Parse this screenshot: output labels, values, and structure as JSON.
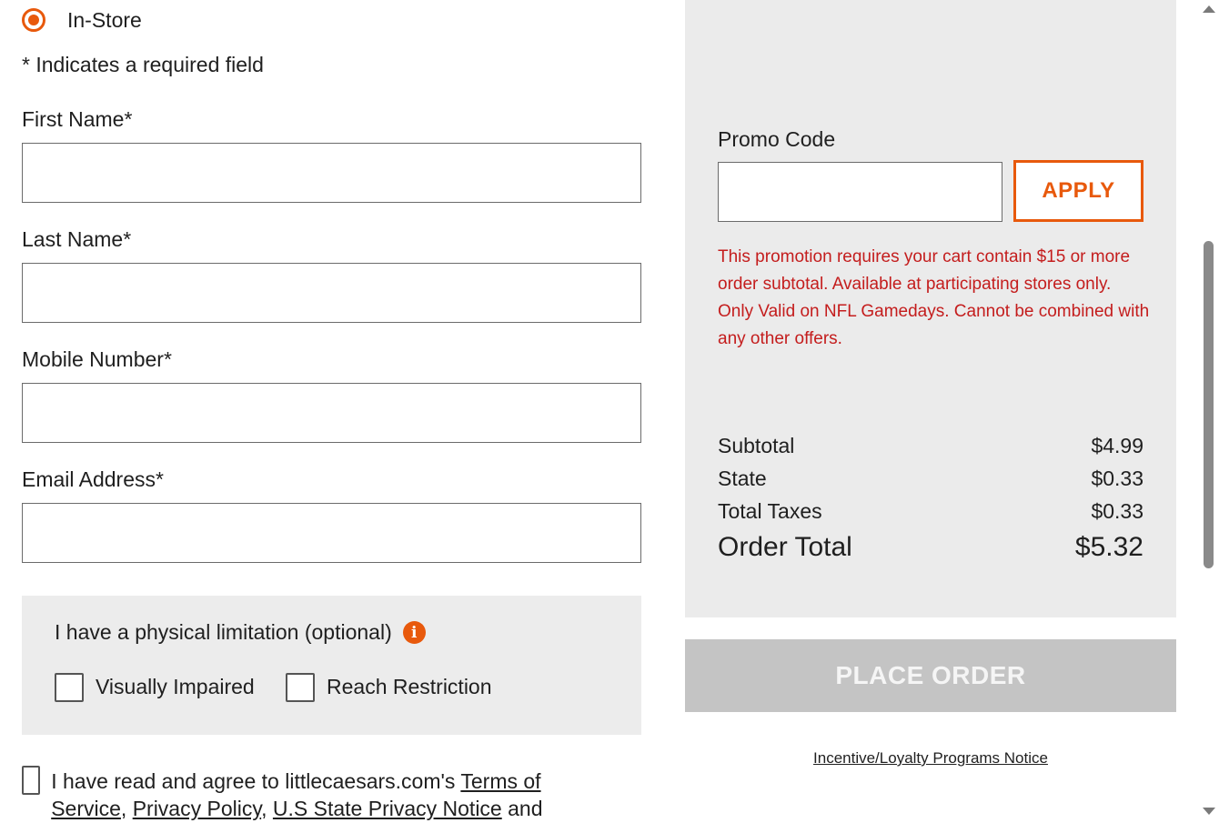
{
  "order_type": {
    "selected_label": "In-Store"
  },
  "form": {
    "required_note": "* Indicates a required field",
    "first_name_label": "First Name*",
    "last_name_label": "Last Name*",
    "mobile_label": "Mobile Number*",
    "email_label": "Email Address*"
  },
  "limitation": {
    "title": "I have a physical limitation (optional)",
    "info_icon": "i",
    "options": [
      "Visually Impaired",
      "Reach Restriction"
    ]
  },
  "agreement": {
    "prefix": "I have read and agree to littlecaesars.com's ",
    "terms": "Terms of Service",
    "sep1": ", ",
    "privacy": "Privacy Policy",
    "sep2": ", ",
    "state_privacy": "U.S State Privacy Notice",
    "suffix": " and"
  },
  "promo": {
    "label": "Promo Code",
    "apply_label": "APPLY",
    "message": "This promotion requires your cart contain $15 or more order subtotal. Available at participating stores only. Only Valid on NFL Gamedays. Cannot be combined with any other offers."
  },
  "summary": {
    "subtotal_label": "Subtotal",
    "subtotal_value": "$4.99",
    "state_label": "State",
    "state_value": "$0.33",
    "taxes_label": "Total Taxes",
    "taxes_value": "$0.33",
    "total_label": "Order Total",
    "total_value": "$5.32"
  },
  "place_order_label": "PLACE ORDER",
  "loyalty_link": "Incentive/Loyalty Programs Notice",
  "colors": {
    "accent": "#e8590c",
    "error": "#c41d1d",
    "panel": "#ebebeb",
    "disabled_button": "#c4c4c4"
  }
}
